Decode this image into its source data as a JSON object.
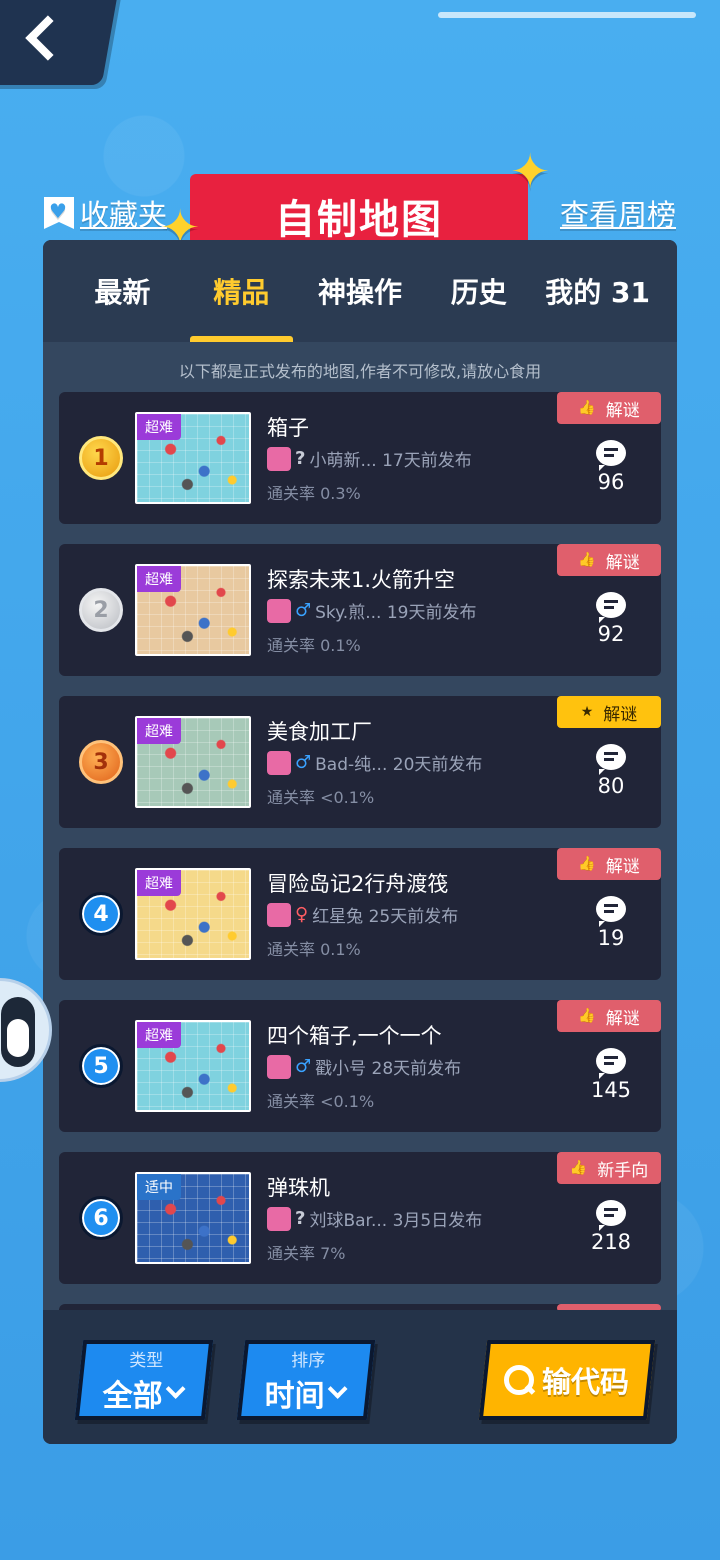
{
  "header": {
    "favorites_label": "收藏夹",
    "title": "自制地图",
    "weekly_label": "查看周榜"
  },
  "tabs": [
    {
      "label": "最新",
      "active": false
    },
    {
      "label": "精品",
      "active": true
    },
    {
      "label": "神操作",
      "active": false
    },
    {
      "label": "历史",
      "active": false
    },
    {
      "label": "我的 31",
      "active": false
    }
  ],
  "notice": "以下都是正式发布的地图,作者不可修改,请放心食用",
  "maps": [
    {
      "rank": "1",
      "rank_style": "gold",
      "difficulty": "超难",
      "title": "箱子",
      "gender": "?",
      "author_info": "小萌新... 17天前发布",
      "clear_rate": "通关率 0.3%",
      "tag": "解谜",
      "tag_style": "normal",
      "comments": "96"
    },
    {
      "rank": "2",
      "rank_style": "silver",
      "difficulty": "超难",
      "title": "探索未来1.火箭升空",
      "gender": "♂",
      "author_info": "Sky.煎... 19天前发布",
      "clear_rate": "通关率 0.1%",
      "tag": "解谜",
      "tag_style": "normal",
      "comments": "92"
    },
    {
      "rank": "3",
      "rank_style": "bronze",
      "difficulty": "超难",
      "title": "美食加工厂",
      "gender": "♂",
      "author_info": "Bad-纯... 20天前发布",
      "clear_rate": "通关率 <0.1%",
      "tag": "解谜",
      "tag_style": "featured",
      "comments": "80"
    },
    {
      "rank": "4",
      "rank_style": "blue",
      "difficulty": "超难",
      "title": "冒险岛记2行舟渡筏",
      "gender": "♀",
      "author_info": "红星兔 25天前发布",
      "clear_rate": "通关率 0.1%",
      "tag": "解谜",
      "tag_style": "normal",
      "comments": "19"
    },
    {
      "rank": "5",
      "rank_style": "blue",
      "difficulty": "超难",
      "title": "四个箱子,一个一个",
      "gender": "♂",
      "author_info": "戳小号 28天前发布",
      "clear_rate": "通关率 <0.1%",
      "tag": "解谜",
      "tag_style": "normal",
      "comments": "145"
    },
    {
      "rank": "6",
      "rank_style": "blue",
      "difficulty": "适中",
      "title": "弹珠机",
      "gender": "?",
      "author_info": "刘球Bar... 3月5日发布",
      "clear_rate": "通关率 7%",
      "tag": "新手向",
      "tag_style": "normal",
      "comments": "218"
    }
  ],
  "bottom": {
    "type_label": "类型",
    "type_value": "全部",
    "sort_label": "排序",
    "sort_value": "时间",
    "code_label": "输代码"
  },
  "colors": {
    "background": "#3aa0ea",
    "banner_red": "#e8213f",
    "tab_active": "#ffcb2e",
    "tag_red": "#e05f6c",
    "tag_yellow": "#ffc20e",
    "button_blue": "#1d8af0",
    "button_yellow": "#ffb400"
  },
  "icons": {
    "back": "back-chevron-icon",
    "favorites": "bookmark-heart-icon",
    "comment": "speech-bubble-icon",
    "like": "thumbs-up-icon",
    "star": "star-icon",
    "search": "search-icon"
  }
}
